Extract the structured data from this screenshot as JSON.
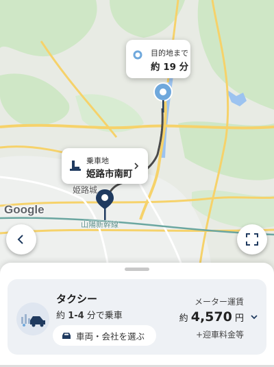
{
  "map": {
    "destination_bubble": {
      "label": "目的地まで",
      "time": "約 19 分"
    },
    "pickup_bubble": {
      "label": "乗車地",
      "place": "姫路市南町"
    },
    "labels": {
      "city": "姫路城",
      "line": "山陽新幹線"
    },
    "attribution": "Google",
    "colors": {
      "land": "#e9ece3",
      "green": "#c8e6c0",
      "road": "#f6d66a",
      "water": "#8ab4f8",
      "pin": "#1f3a5f",
      "dest_pin": "#6fa8dc"
    }
  },
  "controls": {
    "back": "chevron-left-icon",
    "fullscreen": "expand-icon"
  },
  "ride_card": {
    "title": "タクシー",
    "eta_prefix": "約",
    "eta_range": "1-4",
    "eta_suffix": "分で乗車",
    "select_button": "車両・会社を選ぶ",
    "fare_label": "メーター運賃",
    "fare_prefix": "約",
    "fare_amount": "4,570",
    "fare_unit": "円",
    "fare_note": "+迎車料金等"
  }
}
